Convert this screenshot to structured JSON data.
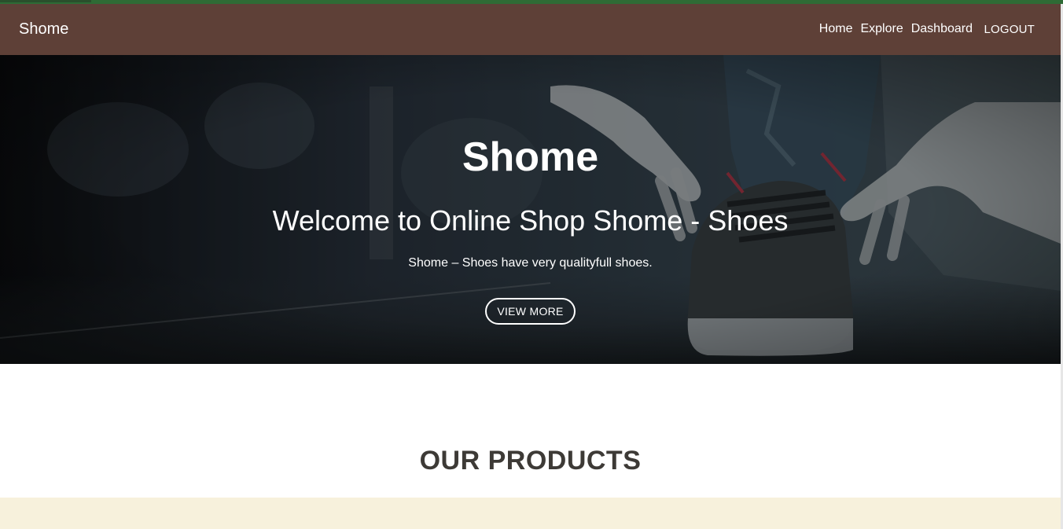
{
  "navbar": {
    "brand": "Shome",
    "links": [
      {
        "label": "Home"
      },
      {
        "label": "Explore"
      },
      {
        "label": "Dashboard"
      }
    ],
    "logout_label": "LOGOUT"
  },
  "hero": {
    "title": "Shome",
    "subtitle": "Welcome to Online Shop Shome - Shoes",
    "text": "Shome – Shoes have very qualityfull shoes.",
    "button_label": "VIEW MORE"
  },
  "products": {
    "heading": "OUR PRODUCTS"
  },
  "colors": {
    "navbar_bg": "#5e4037",
    "accent_green": "#2e6b35",
    "products_strip_bg": "#f7f1dc",
    "heading_text": "#3d3a36"
  }
}
